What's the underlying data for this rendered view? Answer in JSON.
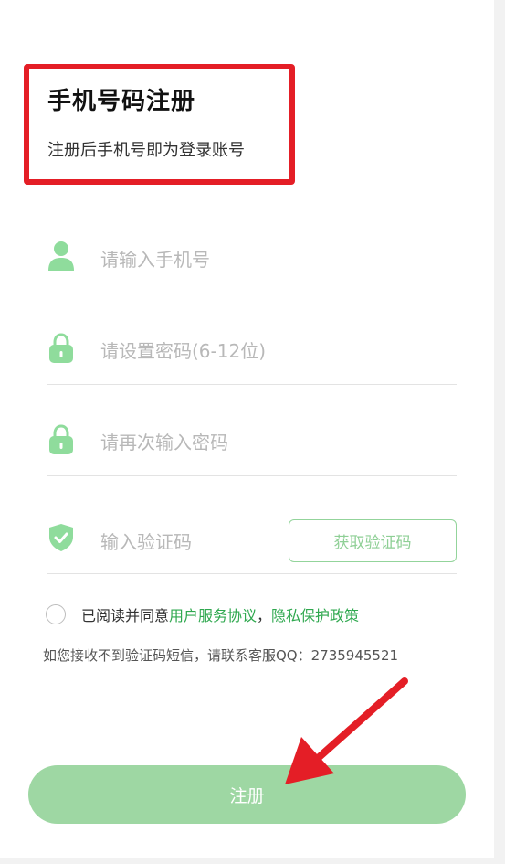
{
  "header": {
    "title": "手机号码注册",
    "subtitle": "注册后手机号即为登录账号"
  },
  "form": {
    "phone": {
      "placeholder": "请输入手机号",
      "icon": "user-icon"
    },
    "password": {
      "placeholder": "请设置密码(6-12位)",
      "icon": "lock-icon"
    },
    "confirm_password": {
      "placeholder": "请再次输入密码",
      "icon": "lock-icon"
    },
    "code": {
      "placeholder": "输入验证码",
      "icon": "shield-check-icon",
      "button_label": "获取验证码"
    }
  },
  "agreement": {
    "checked": false,
    "prefix": "已阅读并同意",
    "user_agreement": "用户服务协议",
    "separator": "，",
    "privacy_policy": "隐私保护政策"
  },
  "contact_note": "如您接收不到验证码短信，请联系客服QQ：2735945521",
  "submit_label": "注册",
  "colors": {
    "accent": "#2fa84f",
    "icon": "#8fdc9c",
    "submit_bg": "#9ed7a3",
    "annotation": "#e41e26"
  }
}
